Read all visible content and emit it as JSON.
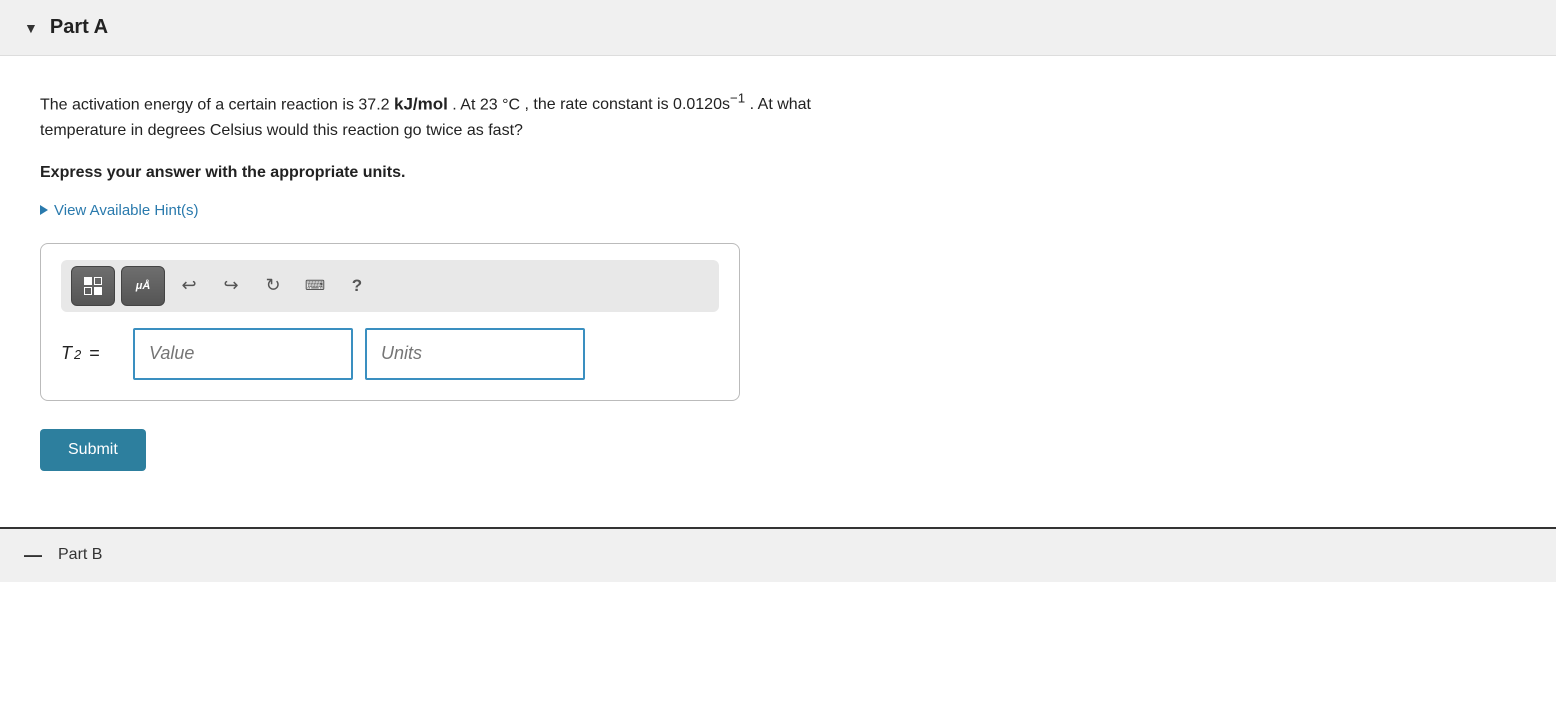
{
  "partA": {
    "chevron": "▼",
    "title": "Part A",
    "question": {
      "line1_start": "The activation energy of a certain reaction is 37.2",
      "math_kj": "kJ/mol",
      "line1_mid": ". At 23",
      "math_celsius": "°C",
      "line1_end": ", the rate constant is 0.0120s",
      "superscript": "−1",
      "line1_after": ". At what",
      "line2": "temperature in degrees Celsius would this reaction go twice as fast?"
    },
    "instruction": "Express your answer with the appropriate units.",
    "hint_label": "View Available Hint(s)",
    "toolbar": {
      "undo_title": "Undo",
      "redo_title": "Redo",
      "reset_title": "Reset",
      "keyboard_title": "Keyboard",
      "help_title": "Help",
      "units_label": "μÅ"
    },
    "input": {
      "label_italic": "T",
      "label_subscript": "2",
      "label_equals": "=",
      "value_placeholder": "Value",
      "units_placeholder": "Units"
    },
    "submit_label": "Submit"
  },
  "partB": {
    "chevron": "—",
    "title": "Part B"
  }
}
